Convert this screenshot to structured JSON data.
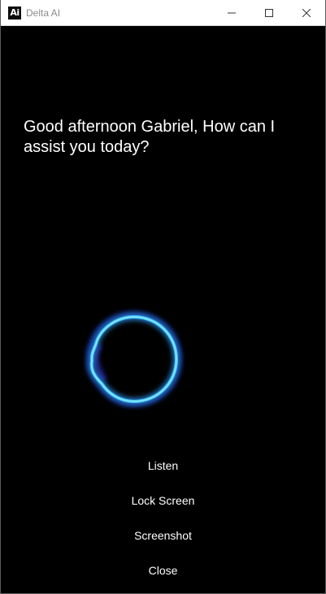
{
  "window": {
    "app_icon_text": "Ai",
    "title": "Delta AI"
  },
  "main": {
    "greeting": "Good afternoon Gabriel, How can I assist you today?"
  },
  "menu": {
    "listen": "Listen",
    "lock_screen": "Lock Screen",
    "screenshot": "Screenshot",
    "close": "Close"
  },
  "colors": {
    "background": "#000000",
    "orb_glow": "#1e90ff",
    "orb_core": "#4fd0ff",
    "text": "#ffffff"
  }
}
